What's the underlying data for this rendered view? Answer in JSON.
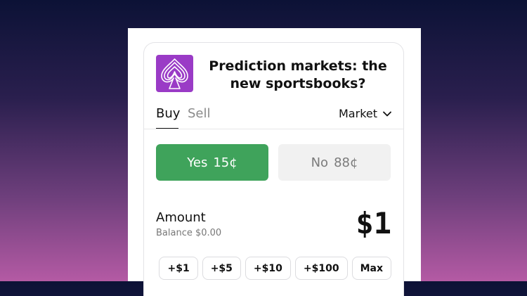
{
  "market": {
    "title": "Prediction markets: the new sportsbooks?",
    "icon": "spade-icon",
    "icon_color": "#9a3bc6"
  },
  "tabs": [
    {
      "label": "Buy",
      "active": true
    },
    {
      "label": "Sell",
      "active": false
    }
  ],
  "order_type": {
    "label": "Market"
  },
  "outcomes": {
    "yes": {
      "label": "Yes",
      "price": "15¢",
      "color": "#3fa35b"
    },
    "no": {
      "label": "No",
      "price": "88¢"
    }
  },
  "amount": {
    "label": "Amount",
    "balance": "Balance $0.00",
    "value": "$1"
  },
  "quick_amounts": [
    "+$1",
    "+$5",
    "+$10",
    "+$100",
    "Max"
  ]
}
